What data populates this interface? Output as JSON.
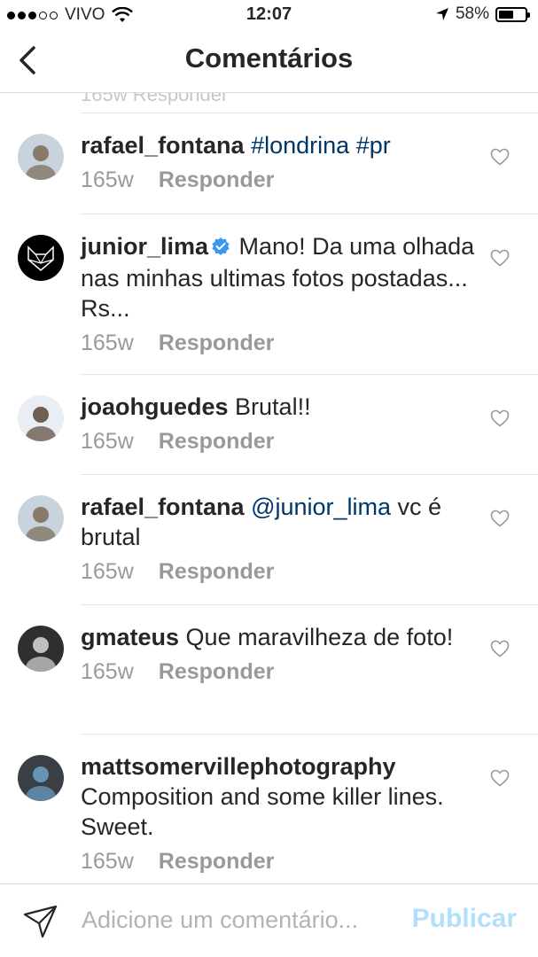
{
  "status_bar": {
    "carrier": "VIVO",
    "time": "12:07",
    "battery": "58%",
    "battery_level": 0.58
  },
  "header": {
    "title": "Comentários"
  },
  "previous_comment": {
    "partial_text": "165w   Responder"
  },
  "comments": [
    {
      "username": "rafael_fontana",
      "verified": false,
      "segments": [
        {
          "text": " "
        },
        {
          "text": "#londrina",
          "link": true
        },
        {
          "text": " "
        },
        {
          "text": "#pr",
          "link": true
        }
      ],
      "time": "165w",
      "reply_label": "Responder",
      "avatar_colors": [
        "#c9d3de",
        "#7b6a55"
      ]
    },
    {
      "username": "junior_lima",
      "verified": true,
      "segments": [
        {
          "text": " Mano! Da uma olhada nas minhas ultimas fotos postadas... Rs..."
        }
      ],
      "time": "165w",
      "reply_label": "Responder",
      "avatar_colors": [
        "#000000",
        "#ffffff"
      ]
    },
    {
      "username": "joaohguedes",
      "verified": false,
      "segments": [
        {
          "text": " Brutal!!"
        }
      ],
      "time": "165w",
      "reply_label": "Responder",
      "avatar_colors": [
        "#e8eef3",
        "#5b4636"
      ]
    },
    {
      "username": "rafael_fontana",
      "verified": false,
      "segments": [
        {
          "text": " "
        },
        {
          "text": "@junior_lima",
          "link": true
        },
        {
          "text": " vc é brutal"
        }
      ],
      "time": "165w",
      "reply_label": "Responder",
      "avatar_colors": [
        "#c9d3de",
        "#7b6a55"
      ]
    },
    {
      "username": "gmateus",
      "verified": false,
      "segments": [
        {
          "text": " Que maravilheza de foto!"
        }
      ],
      "time": "165w",
      "reply_label": "Responder",
      "avatar_colors": [
        "#2f2f2f",
        "#d9d9d9"
      ]
    },
    {
      "username": "mattsomervillephotography",
      "verified": false,
      "segments": [
        {
          "text": " Composition and some killer lines. Sweet."
        }
      ],
      "time": "165w",
      "reply_label": "Responder",
      "avatar_colors": [
        "#3a3f46",
        "#6fa3c9"
      ]
    }
  ],
  "comment_input": {
    "placeholder": "Adicione um comentário...",
    "value": ""
  },
  "publish_label": "Publicar",
  "colors": {
    "link": "#003569",
    "meta": "#999999",
    "publish_disabled": "#b2dffc",
    "verified": "#3897f0"
  },
  "icons": {
    "back": "chevron-left-icon",
    "heart": "heart-outline-icon",
    "send": "paper-plane-icon",
    "verified": "verified-badge-icon"
  }
}
